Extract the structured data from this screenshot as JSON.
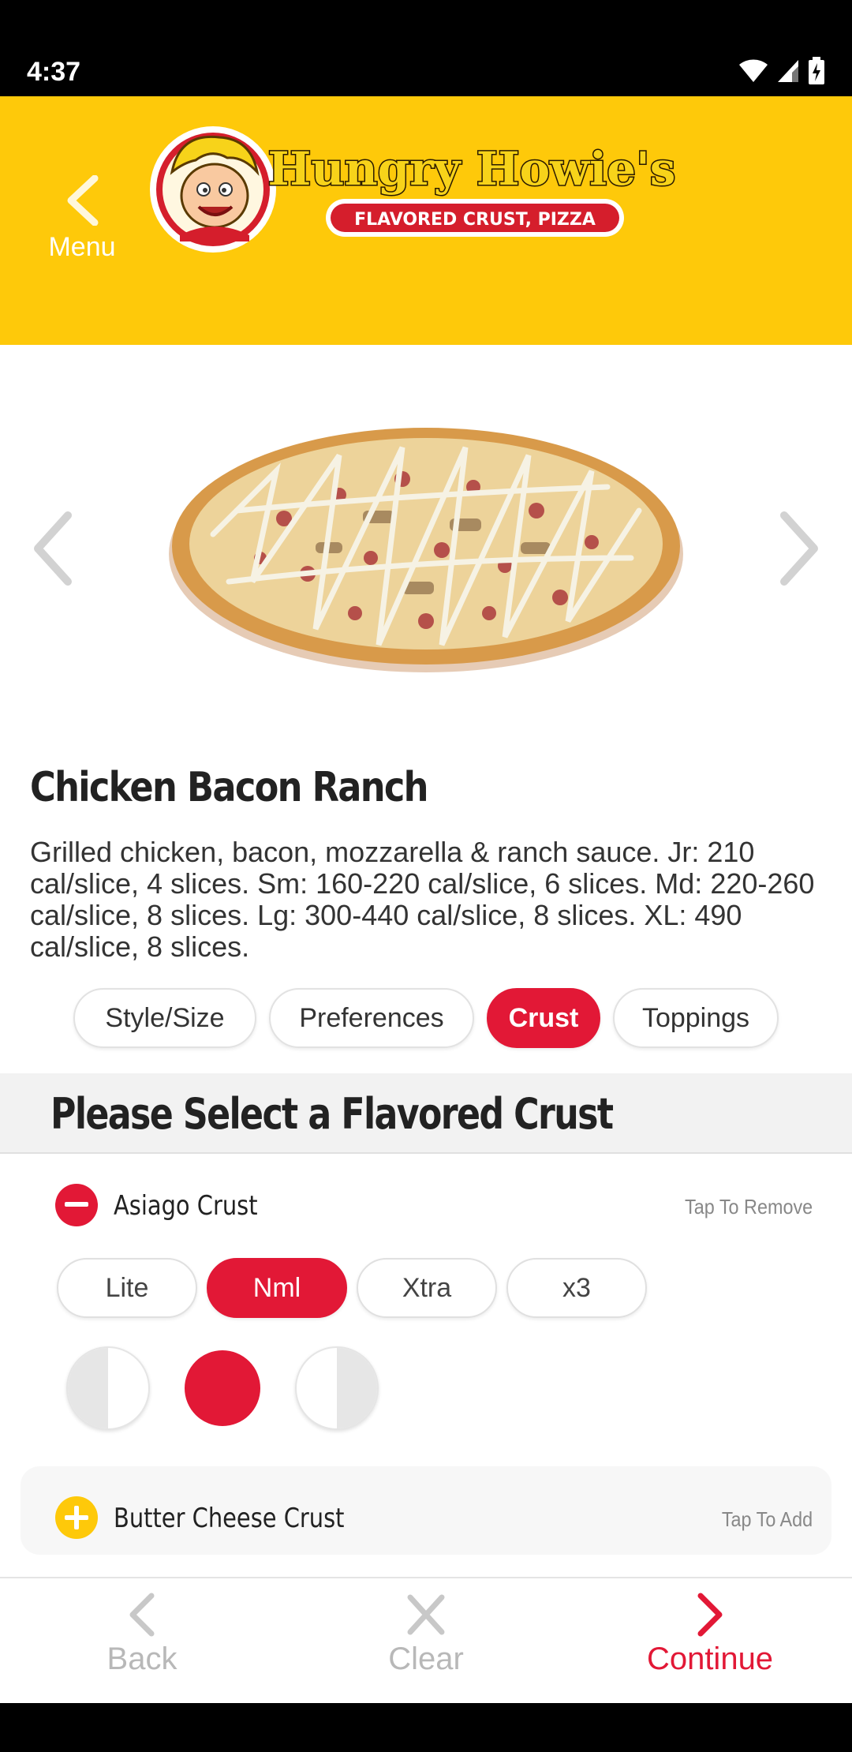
{
  "status_bar": {
    "time": "4:37"
  },
  "header": {
    "back_label": "Menu",
    "brand_name": "Hungry Howie's",
    "brand_tagline": "FLAVORED CRUST, PIZZA",
    "brand_color": "#fec90a"
  },
  "product": {
    "title": "Chicken Bacon Ranch",
    "description": "Grilled chicken, bacon, mozzarella & ranch sauce. Jr: 210 cal/slice, 4 slices. Sm: 160-220 cal/slice, 6 slices. Md: 220-260 cal/slice, 8 slices. Lg: 300-440 cal/slice, 8 slices. XL: 490 cal/slice, 8 slices."
  },
  "tabs": [
    {
      "label": "Style/Size",
      "active": false
    },
    {
      "label": "Preferences",
      "active": false
    },
    {
      "label": "Crust",
      "active": true
    },
    {
      "label": "Toppings",
      "active": false
    }
  ],
  "section": {
    "title": "Please Select a Flavored Crust"
  },
  "crust_options": [
    {
      "name": "Asiago Crust",
      "hint": "Tap To Remove",
      "selected": true,
      "amounts": [
        "Lite",
        "Nml",
        "Xtra",
        "x3"
      ],
      "selected_amount": "Nml",
      "portion": "whole"
    },
    {
      "name": "Butter Cheese Crust",
      "hint": "Tap To Add",
      "selected": false
    }
  ],
  "bottom_nav": {
    "back": "Back",
    "clear": "Clear",
    "continue": "Continue"
  },
  "colors": {
    "accent_red": "#e21836",
    "add_yellow": "#fec90a",
    "inactive_gray": "#b8b8b8"
  }
}
